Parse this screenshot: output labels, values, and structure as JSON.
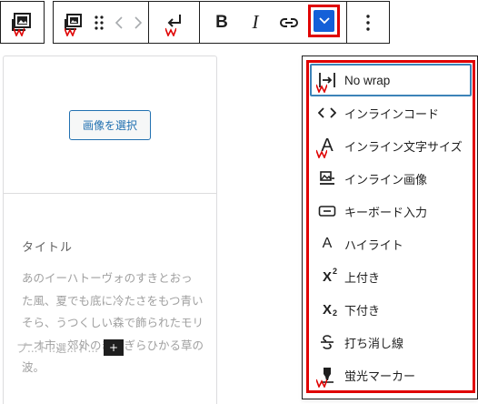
{
  "toolbar": {
    "brand_red": "#e00000",
    "accent_blue": "#1460d8",
    "bold_label": "B",
    "italic_label": "I"
  },
  "card": {
    "select_image_label": "画像を選択",
    "title": "タイトル",
    "body": "あのイーハトーヴォのすきとおった風、夏でも底に冷たさをもつ青いそら、うつくしい森で飾られたモリーオ市、郊外のぎらぎらひかる草の波。",
    "cut_text": "ブ...ト..選...ト..."
  },
  "menu": {
    "items": [
      {
        "label": "No wrap",
        "icon": "no-wrap-icon"
      },
      {
        "label": "インラインコード",
        "icon": "code-icon"
      },
      {
        "label": "インライン文字サイズ",
        "icon": "font-size-icon"
      },
      {
        "label": "インライン画像",
        "icon": "inline-image-icon"
      },
      {
        "label": "キーボード入力",
        "icon": "keyboard-icon"
      },
      {
        "label": "ハイライト",
        "icon": "highlight-icon"
      },
      {
        "label": "上付き",
        "icon": "superscript-icon"
      },
      {
        "label": "下付き",
        "icon": "subscript-icon"
      },
      {
        "label": "打ち消し線",
        "icon": "strikethrough-icon"
      },
      {
        "label": "蛍光マーカー",
        "icon": "marker-icon"
      }
    ],
    "glyphs": {
      "font_size": "A",
      "highlight": "A",
      "superscript_base": "X",
      "superscript_mark": "2",
      "subscript_base": "X",
      "subscript_mark": "2"
    }
  }
}
